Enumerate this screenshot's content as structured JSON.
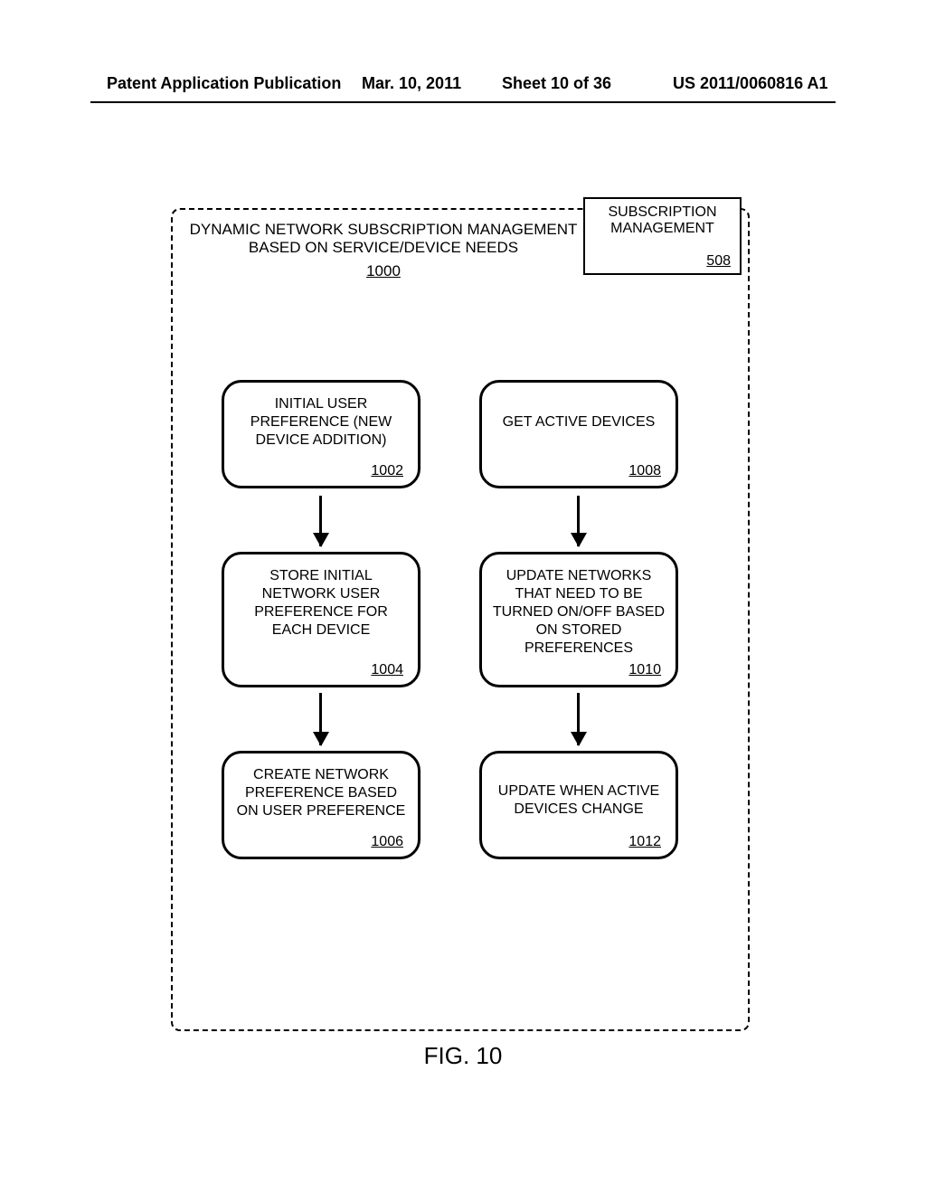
{
  "header": {
    "pub_type": "Patent Application Publication",
    "date": "Mar. 10, 2011",
    "sheet": "Sheet 10 of 36",
    "pub_no": "US 2011/0060816 A1"
  },
  "diagram": {
    "title": "DYNAMIC NETWORK SUBSCRIPTION MANAGEMENT BASED ON SERVICE/DEVICE NEEDS",
    "title_ref": "1000",
    "sub_mgmt": {
      "label": "SUBSCRIPTION MANAGEMENT",
      "ref": "508"
    },
    "boxes": {
      "b1002": {
        "text": "INITIAL USER PREFERENCE (NEW DEVICE ADDITION)",
        "ref": "1002"
      },
      "b1004": {
        "text": "STORE INITIAL NETWORK USER PREFERENCE FOR EACH DEVICE",
        "ref": "1004"
      },
      "b1006": {
        "text": "CREATE NETWORK PREFERENCE BASED ON USER PREFERENCE",
        "ref": "1006"
      },
      "b1008": {
        "text": "GET ACTIVE DEVICES",
        "ref": "1008"
      },
      "b1010": {
        "text": "UPDATE NETWORKS THAT NEED TO BE TURNED ON/OFF BASED ON STORED PREFERENCES",
        "ref": "1010"
      },
      "b1012": {
        "text": "UPDATE WHEN ACTIVE DEVICES CHANGE",
        "ref": "1012"
      }
    }
  },
  "figure_label": "FIG. 10"
}
